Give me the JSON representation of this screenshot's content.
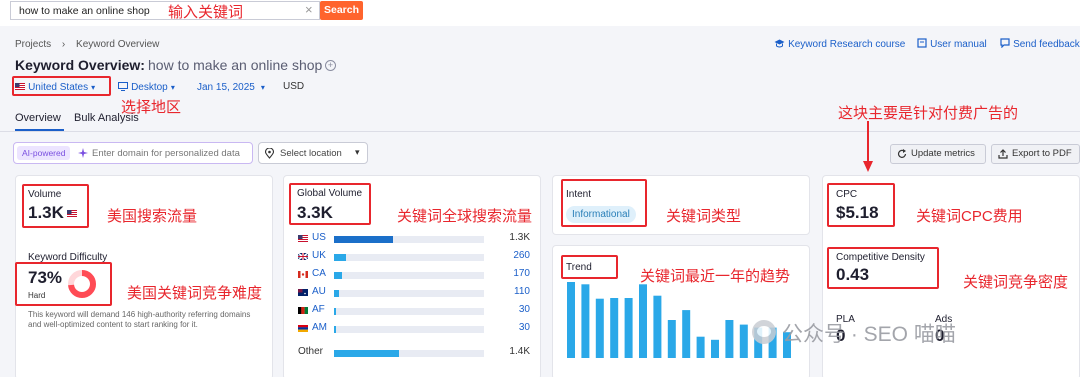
{
  "search": {
    "query": "how to make an online shop",
    "clear_glyph": "×",
    "button": "Search"
  },
  "annotations": {
    "input_keyword": "输入关键词",
    "select_region": "选择地区",
    "paid_ads_note": "这块主要是针对付费广告的",
    "us_volume": "美国搜索流量",
    "global_volume": "关键词全球搜索流量",
    "intent_type": "关键词类型",
    "cpc_cost": "关键词CPC费用",
    "us_difficulty": "美国关键词竞争难度",
    "trend_year": "关键词最近一年的趋势",
    "competitive_density": "关键词竞争密度"
  },
  "breadcrumb": {
    "projects": "Projects",
    "separator": "›",
    "current": "Keyword Overview"
  },
  "header": {
    "title": "Keyword Overview:",
    "keyword": "how to make an online shop",
    "links": [
      "Keyword Research course",
      "User manual",
      "Send feedback"
    ]
  },
  "filters": {
    "country": "United States",
    "device": "Desktop",
    "date": "Jan 15, 2025",
    "currency": "USD"
  },
  "tabs": [
    "Overview",
    "Bulk Analysis"
  ],
  "toolbar": {
    "ai_tag": "AI-powered",
    "domain_placeholder": "Enter domain for personalized data",
    "location_placeholder": "Select location",
    "update_metrics": "Update metrics",
    "export_pdf": "Export to PDF"
  },
  "volume": {
    "label": "Volume",
    "value": "1.3K"
  },
  "difficulty": {
    "label": "Keyword Difficulty",
    "value": "73%",
    "level": "Hard",
    "percent": 73,
    "description": "This keyword will demand 146 high-authority referring domains and well-optimized content to start ranking for it."
  },
  "global_volume": {
    "label": "Global Volume",
    "value": "3.3K",
    "countries": [
      {
        "code": "US",
        "value": "1.3K",
        "fill": 0.39
      },
      {
        "code": "UK",
        "value": "260",
        "fill": 0.08
      },
      {
        "code": "CA",
        "value": "170",
        "fill": 0.05
      },
      {
        "code": "AU",
        "value": "110",
        "fill": 0.035
      },
      {
        "code": "AF",
        "value": "30",
        "fill": 0.012
      },
      {
        "code": "AM",
        "value": "30",
        "fill": 0.012
      }
    ],
    "other": {
      "label": "Other",
      "value": "1.4K",
      "fill": 0.43
    }
  },
  "intent": {
    "label": "Intent",
    "value": "Informational"
  },
  "trend": {
    "label": "Trend",
    "bars": [
      1.0,
      0.97,
      0.78,
      0.79,
      0.79,
      0.97,
      0.82,
      0.5,
      0.63,
      0.28,
      0.24,
      0.5,
      0.44,
      0.4,
      0.4,
      0.34
    ]
  },
  "cpc": {
    "label": "CPC",
    "value": "$5.18"
  },
  "density": {
    "label": "Competitive Density",
    "value": "0.43"
  },
  "pla": {
    "label": "PLA",
    "value": "0"
  },
  "ads": {
    "label": "Ads",
    "value": "0"
  },
  "watermark": "公众号 · SEO 喵喵",
  "colors": {
    "accent": "#1b5fc9",
    "search_button": "#ff642d",
    "annotation_red": "#e8262d",
    "bar_blue": "#2aa8e8",
    "us_bar": "#1b6fc9",
    "difficulty_ring": "#ff4b55"
  }
}
